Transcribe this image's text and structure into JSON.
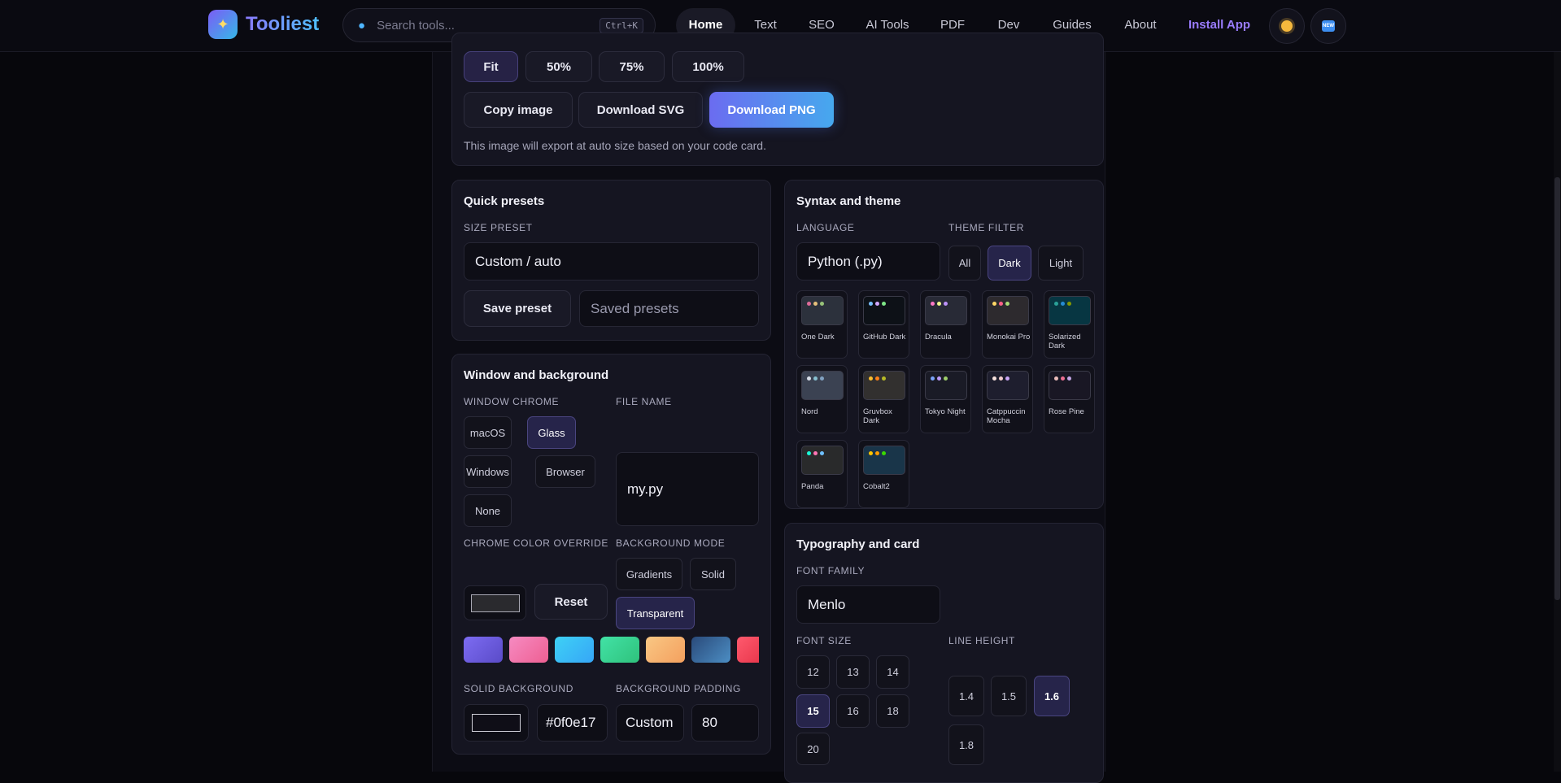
{
  "header": {
    "logo_text": "Tooliest",
    "search_placeholder": "Search tools...",
    "search_shortcut": "Ctrl+K",
    "nav": [
      {
        "label": "Home",
        "active": true
      },
      {
        "label": "Text"
      },
      {
        "label": "SEO"
      },
      {
        "label": "AI Tools"
      },
      {
        "label": "PDF"
      },
      {
        "label": "Dev"
      },
      {
        "label": "Guides"
      },
      {
        "label": "About"
      }
    ],
    "install_label": "Install App",
    "lang_icon_text": "NEW"
  },
  "export": {
    "zoom_options": [
      "Fit",
      "50%",
      "75%",
      "100%"
    ],
    "zoom_selected": "Fit",
    "copy_label": "Copy image",
    "svg_label": "Download SVG",
    "png_label": "Download PNG",
    "note": "This image will export at auto size based on your code card."
  },
  "presets": {
    "title": "Quick presets",
    "size_label": "SIZE PRESET",
    "size_value": "Custom / auto",
    "save_label": "Save preset",
    "saved_placeholder": "Saved presets"
  },
  "window": {
    "title": "Window and background",
    "chrome_label": "WINDOW CHROME",
    "chrome_options": [
      "macOS",
      "Glass",
      "Windows",
      "Browser",
      "None"
    ],
    "chrome_selected": "Glass",
    "file_label": "FILE NAME",
    "file_value": "my.py",
    "override_label": "CHROME COLOR OVERRIDE",
    "reset_label": "Reset",
    "bg_mode_label": "BACKGROUND MODE",
    "bg_modes": [
      "Gradients",
      "Solid",
      "Transparent"
    ],
    "bg_mode_selected": "Transparent",
    "swatches": [
      "linear-gradient(135deg,#7d6cf2,#5a4bc8)",
      "linear-gradient(135deg,#f68bc2,#ee5f92)",
      "linear-gradient(135deg,#3ed1f5,#36a6f7)",
      "linear-gradient(135deg,#42e2a6,#2fc27c)",
      "linear-gradient(135deg,#f9c784,#f4a05e)",
      "linear-gradient(135deg,#2a4a7a,#4c8ec4)",
      "linear-gradient(135deg,#ff5a6e,#e9384d)"
    ],
    "solid_label": "SOLID BACKGROUND",
    "solid_hex": "#0f0e17",
    "padding_label": "BACKGROUND PADDING",
    "padding_mode": "Custom",
    "padding_value": "80"
  },
  "syntax": {
    "title": "Syntax and theme",
    "language_label": "LANGUAGE",
    "language_value": "Python (.py)",
    "filter_label": "THEME FILTER",
    "filters": [
      "All",
      "Dark",
      "Light"
    ],
    "filter_selected": "Dark",
    "themes": [
      {
        "name": "One Dark",
        "bg": "#2c313c",
        "dots": [
          "#e06c9a",
          "#e5c07b",
          "#98c379"
        ]
      },
      {
        "name": "GitHub Dark",
        "bg": "#0d1117",
        "dots": [
          "#79c0ff",
          "#d2a8ff",
          "#7ee787"
        ]
      },
      {
        "name": "Dracula",
        "bg": "#282a36",
        "dots": [
          "#ff79c6",
          "#f1fa8c",
          "#bd93f9"
        ]
      },
      {
        "name": "Monokai Pro",
        "bg": "#2d2a2e",
        "dots": [
          "#ffd866",
          "#ff6188",
          "#a9dc76"
        ]
      },
      {
        "name": "Solarized Dark",
        "bg": "#073642",
        "dots": [
          "#2aa198",
          "#268bd2",
          "#859900"
        ]
      },
      {
        "name": "Nord",
        "bg": "#3b4252",
        "dots": [
          "#d8dee9",
          "#88c0d0",
          "#81a1c1"
        ]
      },
      {
        "name": "Gruvbox Dark",
        "bg": "#32302f",
        "dots": [
          "#fabd2f",
          "#fe8019",
          "#b8bb26"
        ]
      },
      {
        "name": "Tokyo Night",
        "bg": "#1a1b26",
        "dots": [
          "#7aa2f7",
          "#bb9af7",
          "#9ece6a"
        ]
      },
      {
        "name": "Catppuccin Mocha",
        "bg": "#1e1e2e",
        "dots": [
          "#f5e0dc",
          "#f2cdcd",
          "#cba6f7"
        ]
      },
      {
        "name": "Rose Pine",
        "bg": "#191724",
        "dots": [
          "#ebbcba",
          "#eb6f92",
          "#c4a7e7"
        ]
      },
      {
        "name": "Panda",
        "bg": "#292a2b",
        "dots": [
          "#19f9d8",
          "#ff75b5",
          "#6fc1ff"
        ]
      },
      {
        "name": "Cobalt2",
        "bg": "#193549",
        "dots": [
          "#ffc600",
          "#ff9d00",
          "#3ad900"
        ]
      }
    ]
  },
  "typography": {
    "title": "Typography and card",
    "font_label": "FONT FAMILY",
    "font_value": "Menlo",
    "size_label": "FONT SIZE",
    "sizes": [
      "12",
      "13",
      "14",
      "15",
      "16",
      "18",
      "20"
    ],
    "size_selected": "15",
    "lh_label": "LINE HEIGHT",
    "line_heights": [
      "1.4",
      "1.5",
      "1.6",
      "1.8"
    ],
    "lh_selected": "1.6"
  }
}
